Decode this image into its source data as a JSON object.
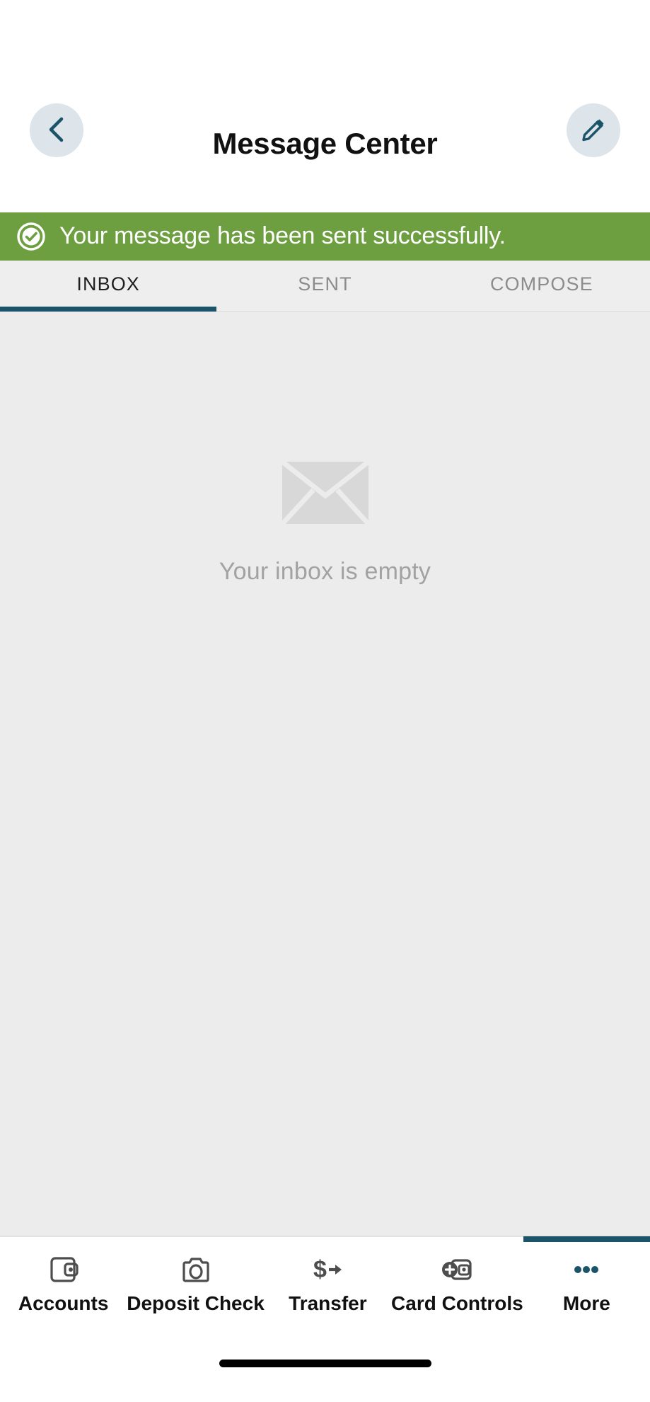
{
  "header": {
    "title": "Message Center",
    "back_icon": "chevron-left-icon",
    "compose_icon": "pencil-icon",
    "accent_color": "#1b5369",
    "circle_bg": "#dde5ea"
  },
  "banner": {
    "text": "Your message has been sent successfully.",
    "icon": "check-circle-icon",
    "bg_color": "#6d9f40",
    "text_color": "#ffffff"
  },
  "tabs": {
    "items": [
      {
        "label": "INBOX",
        "active": true
      },
      {
        "label": "SENT",
        "active": false
      },
      {
        "label": "COMPOSE",
        "active": false
      }
    ],
    "active_underline_color": "#1b5369"
  },
  "content": {
    "empty_icon": "envelope-icon",
    "empty_text": "Your inbox is empty",
    "bg_color": "#ececec"
  },
  "bottom_nav": {
    "items": [
      {
        "label": "Accounts",
        "icon": "wallet-icon",
        "active": false
      },
      {
        "label": "Deposit Check",
        "icon": "camera-icon",
        "active": false
      },
      {
        "label": "Transfer",
        "icon": "dollar-arrow-icon",
        "active": false
      },
      {
        "label": "Card Controls",
        "icon": "card-plus-icon",
        "active": false
      },
      {
        "label": "More",
        "icon": "ellipsis-icon",
        "active": true
      }
    ],
    "active_indicator_color": "#1b5369"
  },
  "home_indicator": {
    "present": true
  }
}
